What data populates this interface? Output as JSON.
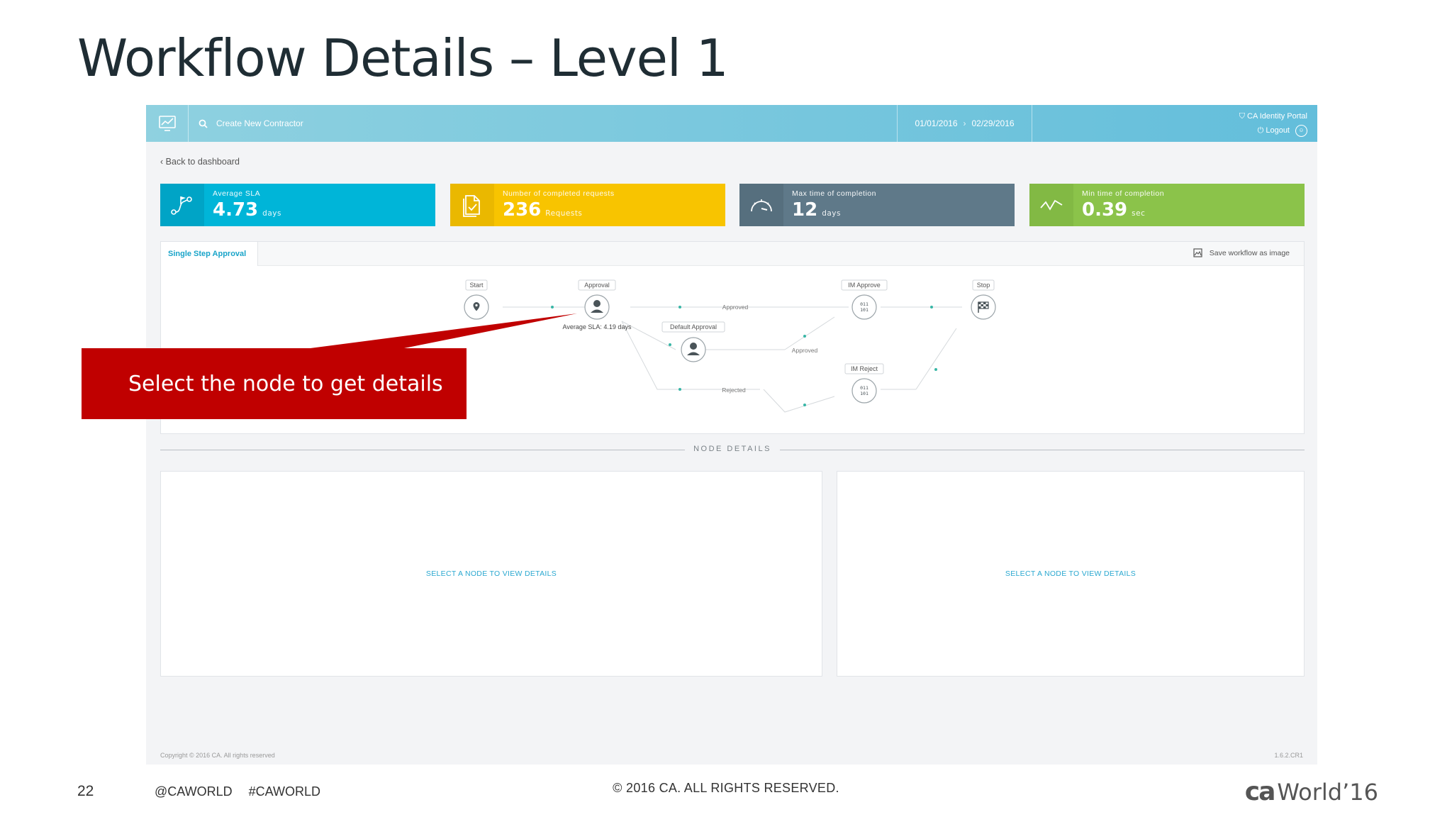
{
  "slide": {
    "title": "Workflow Details – Level 1",
    "page_number": "22",
    "social": [
      "@CAWORLD",
      "#CAWORLD"
    ],
    "copyright": "© 2016 CA. ALL RIGHTS RESERVED.",
    "brand_prefix": "ca",
    "brand_name": "World’16"
  },
  "topbar": {
    "search_text": "Create New Contractor",
    "date_from": "01/01/2016",
    "date_to": "02/29/2016",
    "portal_name": "CA Identity Portal",
    "logout_label": "Logout"
  },
  "back_link": "Back to dashboard",
  "stats": [
    {
      "label": "Average SLA",
      "value": "4.73",
      "unit": "days",
      "color": "#00b5d8"
    },
    {
      "label": "Number of completed requests",
      "value": "236",
      "unit": "Requests",
      "color": "#f8c400"
    },
    {
      "label": "Max time of completion",
      "value": "12",
      "unit": "days",
      "color": "#5f7989"
    },
    {
      "label": "Min time of completion",
      "value": "0.39",
      "unit": "sec",
      "color": "#8bc34a"
    }
  ],
  "workflow": {
    "tab_label": "Single Step Approval",
    "save_label": "Save workflow as image",
    "nodes": {
      "start": "Start",
      "approval": "Approval",
      "approval_sla": "Average SLA: 4.19 days",
      "im_approve": "IM Approve",
      "stop": "Stop",
      "default_approval": "Default Approval",
      "im_reject": "IM Reject"
    },
    "edges": {
      "approved_top": "Approved",
      "approved_mid": "Approved",
      "rejected": "Rejected"
    }
  },
  "callout": "Select the node to get details",
  "node_details": {
    "title": "NODE DETAILS",
    "left_placeholder": "SELECT A NODE TO VIEW DETAILS",
    "right_placeholder": "SELECT A NODE TO VIEW DETAILS"
  },
  "app_footer": {
    "copyright": "Copyright © 2016 CA. All rights reserved",
    "version": "1.6.2.CR1"
  }
}
